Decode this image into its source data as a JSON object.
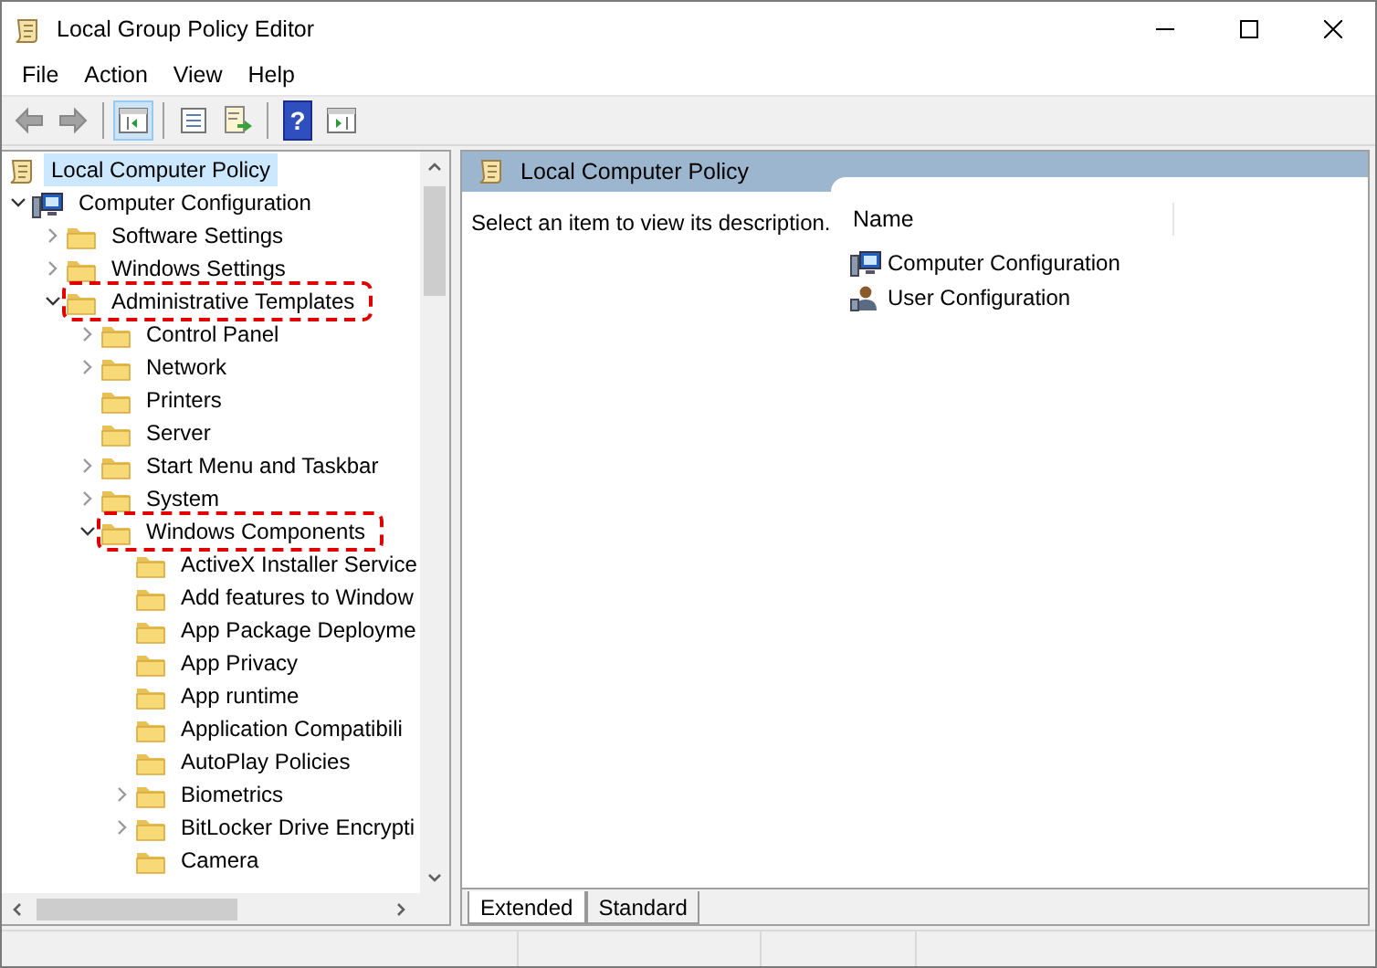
{
  "window": {
    "title": "Local Group Policy Editor"
  },
  "menu": [
    "File",
    "Action",
    "View",
    "Help"
  ],
  "toolbar": [
    {
      "kind": "back",
      "disabled": true,
      "pressed": false
    },
    {
      "kind": "forward",
      "disabled": true,
      "pressed": false
    },
    {
      "kind": "console-tree",
      "disabled": false,
      "pressed": true
    },
    {
      "kind": "properties",
      "disabled": false,
      "pressed": false
    },
    {
      "kind": "export",
      "disabled": false,
      "pressed": false
    },
    {
      "kind": "help",
      "glyph": "?",
      "disabled": false,
      "pressed": false
    },
    {
      "kind": "action-pane",
      "disabled": false,
      "pressed": false
    }
  ],
  "tree": [
    {
      "label": "Local Computer Policy",
      "kind": "root",
      "selected": true,
      "highlighted": false,
      "children": [
        {
          "label": "Computer Configuration",
          "kind": "branch",
          "selected": false,
          "expanded": true,
          "highlighted": false,
          "children": [
            {
              "label": "Software Settings",
              "kind": "branch",
              "selected": false,
              "expanded": false,
              "highlighted": false
            },
            {
              "label": "Windows Settings",
              "kind": "branch",
              "selected": false,
              "expanded": false,
              "highlighted": false
            },
            {
              "label": "Administrative Templates",
              "kind": "branch",
              "selected": false,
              "expanded": true,
              "highlighted": true,
              "children": [
                {
                  "label": "Control Panel",
                  "kind": "branch",
                  "selected": false,
                  "expanded": false,
                  "highlighted": false
                },
                {
                  "label": "Network",
                  "kind": "branch",
                  "selected": false,
                  "expanded": false,
                  "highlighted": false
                },
                {
                  "label": "Printers",
                  "kind": "leaf",
                  "selected": false,
                  "highlighted": false
                },
                {
                  "label": "Server",
                  "kind": "leaf",
                  "selected": false,
                  "highlighted": false
                },
                {
                  "label": "Start Menu and Taskbar",
                  "kind": "branch",
                  "selected": false,
                  "expanded": false,
                  "highlighted": false
                },
                {
                  "label": "System",
                  "kind": "branch",
                  "selected": false,
                  "expanded": false,
                  "highlighted": false
                },
                {
                  "label": "Windows Components",
                  "kind": "branch",
                  "selected": false,
                  "expanded": true,
                  "highlighted": true,
                  "children": [
                    {
                      "label": "ActiveX Installer Service",
                      "kind": "leaf",
                      "selected": false,
                      "highlighted": false
                    },
                    {
                      "label": "Add features to Window",
                      "kind": "leaf",
                      "selected": false,
                      "highlighted": false
                    },
                    {
                      "label": "App Package Deployme",
                      "kind": "leaf",
                      "selected": false,
                      "highlighted": false
                    },
                    {
                      "label": "App Privacy",
                      "kind": "leaf",
                      "selected": false,
                      "highlighted": false
                    },
                    {
                      "label": "App runtime",
                      "kind": "leaf",
                      "selected": false,
                      "highlighted": false
                    },
                    {
                      "label": "Application Compatibili",
                      "kind": "leaf",
                      "selected": false,
                      "highlighted": false
                    },
                    {
                      "label": "AutoPlay Policies",
                      "kind": "leaf",
                      "selected": false,
                      "highlighted": false
                    },
                    {
                      "label": "Biometrics",
                      "kind": "branch",
                      "selected": false,
                      "expanded": false,
                      "highlighted": false
                    },
                    {
                      "label": "BitLocker Drive Encrypti",
                      "kind": "branch",
                      "selected": false,
                      "expanded": false,
                      "highlighted": false
                    },
                    {
                      "label": "Camera",
                      "kind": "leaf",
                      "selected": false,
                      "highlighted": false
                    }
                  ]
                }
              ]
            }
          ]
        }
      ]
    }
  ],
  "details": {
    "title": "Local Computer Policy",
    "description": "Select an item to view its description.",
    "column": "Name",
    "items": [
      {
        "label": "Computer Configuration"
      },
      {
        "label": "User Configuration"
      }
    ]
  },
  "view_tabs": [
    {
      "label": "Extended",
      "selected": true
    },
    {
      "label": "Standard",
      "selected": false
    }
  ]
}
